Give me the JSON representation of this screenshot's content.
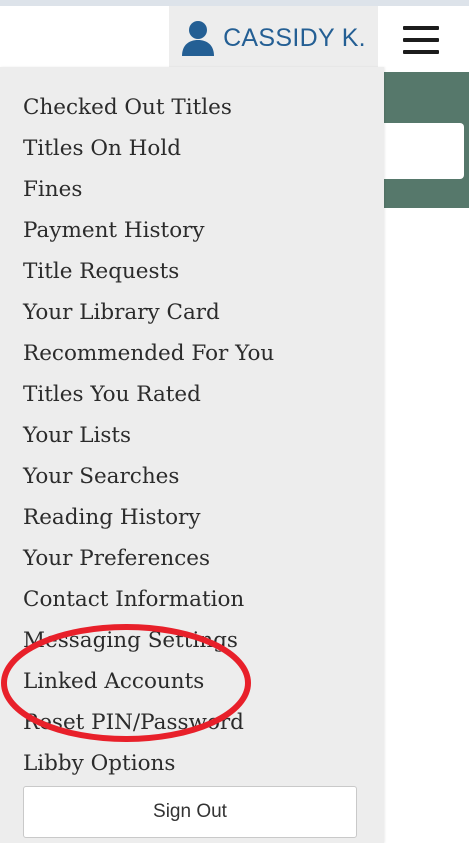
{
  "header": {
    "user_name": "CASSIDY K.",
    "user_icon": "user-icon",
    "menu_icon": "hamburger-menu-icon"
  },
  "menu": {
    "items": [
      {
        "label": "Checked Out Titles"
      },
      {
        "label": "Titles On Hold"
      },
      {
        "label": "Fines"
      },
      {
        "label": "Payment History"
      },
      {
        "label": "Title Requests"
      },
      {
        "label": "Your Library Card"
      },
      {
        "label": "Recommended For You"
      },
      {
        "label": "Titles You Rated"
      },
      {
        "label": "Your Lists"
      },
      {
        "label": "Your Searches"
      },
      {
        "label": "Reading History"
      },
      {
        "label": "Your Preferences"
      },
      {
        "label": "Contact Information"
      },
      {
        "label": "Messaging Settings"
      },
      {
        "label": "Linked Accounts"
      },
      {
        "label": "Reset PIN/Password"
      },
      {
        "label": "Libby Options"
      }
    ],
    "sign_out_label": "Sign Out"
  },
  "colors": {
    "brand_blue": "#245f94",
    "teal_band": "#56786b",
    "menu_background": "#ededed",
    "annotation_red": "#e8202a"
  }
}
